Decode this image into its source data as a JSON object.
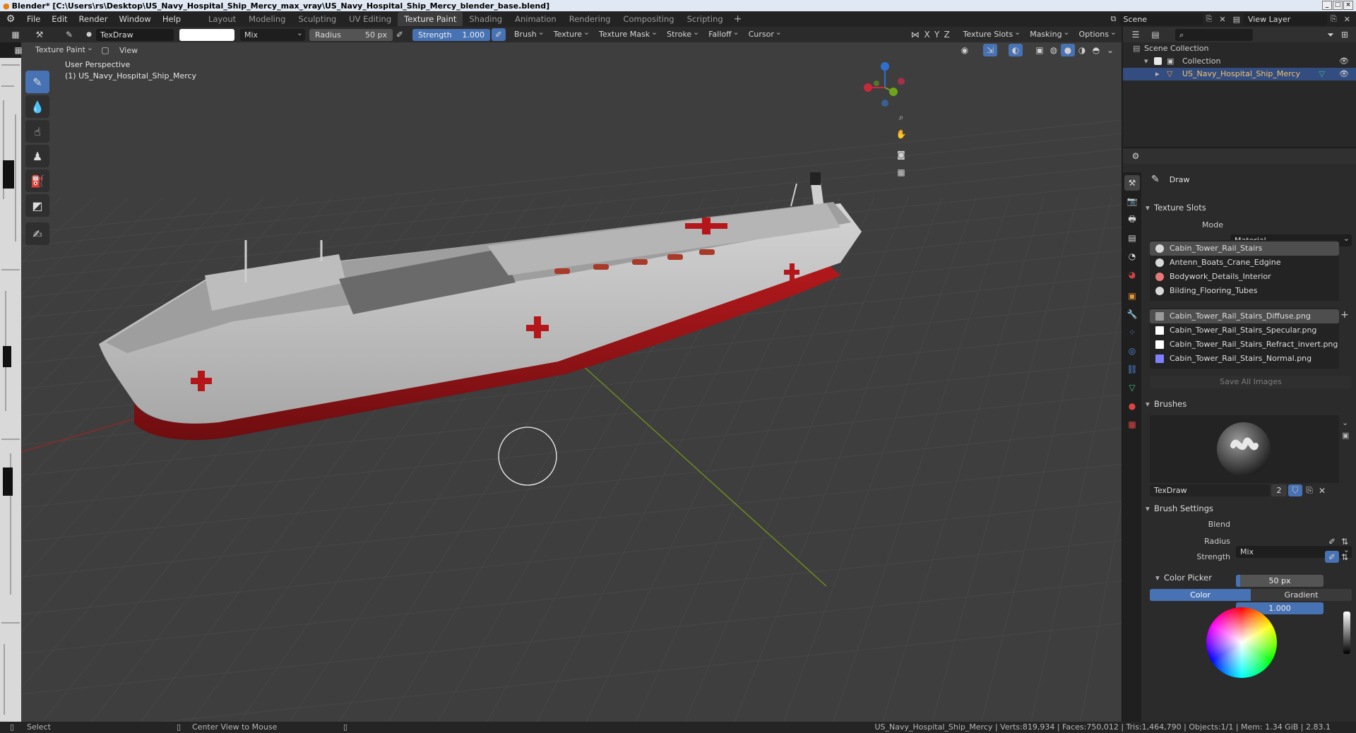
{
  "window": {
    "title": "Blender* [C:\\Users\\rs\\Desktop\\US_Navy_Hospital_Ship_Mercy_max_vray\\US_Navy_Hospital_Ship_Mercy_blender_base.blend]"
  },
  "menu": [
    "File",
    "Edit",
    "Render",
    "Window",
    "Help"
  ],
  "workspaces": [
    "Layout",
    "Modeling",
    "Sculpting",
    "UV Editing",
    "Texture Paint",
    "Shading",
    "Animation",
    "Rendering",
    "Compositing",
    "Scripting"
  ],
  "active_workspace": "Texture Paint",
  "scene": {
    "name": "Scene",
    "view_layer": "View Layer"
  },
  "tool_header": {
    "brush_name": "TexDraw",
    "blend": "Mix",
    "radius_label": "Radius",
    "radius_value": "50 px",
    "strength_label": "Strength",
    "strength_value": "1.000",
    "strength_fraction": 1.0,
    "dropdowns": [
      "Brush",
      "Texture",
      "Texture Mask",
      "Stroke",
      "Falloff",
      "Cursor"
    ],
    "axes": [
      "X",
      "Y",
      "Z"
    ],
    "right_dropdowns": [
      "Texture Slots",
      "Masking",
      "Options"
    ]
  },
  "view_header": {
    "mode": "Texture Paint",
    "view": "View"
  },
  "viewport": {
    "perspective": "User Perspective",
    "object_label": "(1) US_Navy_Hospital_Ship_Mercy"
  },
  "outliner": {
    "root": "Scene Collection",
    "collection": "Collection",
    "object": "US_Navy_Hospital_Ship_Mercy"
  },
  "properties": {
    "tool_name": "Draw",
    "texture_slots_title": "Texture Slots",
    "mode_label": "Mode",
    "mode_value": "Material",
    "materials": [
      "Cabin_Tower_Rail_Stairs",
      "Antenn_Boats_Crane_Edgine",
      "Bodywork_Details_Interior",
      "Bilding_Flooring_Tubes"
    ],
    "images": [
      "Cabin_Tower_Rail_Stairs_Diffuse.png",
      "Cabin_Tower_Rail_Stairs_Specular.png",
      "Cabin_Tower_Rail_Stairs_Refract_invert.png",
      "Cabin_Tower_Rail_Stairs_Normal.png"
    ],
    "save_all": "Save All Images",
    "brushes_title": "Brushes",
    "brush_name": "TexDraw",
    "brush_users": "2",
    "brush_settings_title": "Brush Settings",
    "blend_label": "Blend",
    "blend_value": "Mix",
    "radius_label": "Radius",
    "radius_value": "50 px",
    "strength_label": "Strength",
    "strength_value": "1.000",
    "color_picker_title": "Color Picker",
    "color_tab": "Color",
    "gradient_tab": "Gradient"
  },
  "statusbar": {
    "select": "Select",
    "center": "Center View to Mouse",
    "stats": "US_Navy_Hospital_Ship_Mercy | Verts:819,934 | Faces:750,012 | Tris:1,464,790 | Objects:1/1 | Mem: 1.34 GiB | 2.83.1"
  },
  "colors": {
    "accent": "#4772b3",
    "hull_red": "#a3191c",
    "ship_white": "#c9c9c9"
  }
}
